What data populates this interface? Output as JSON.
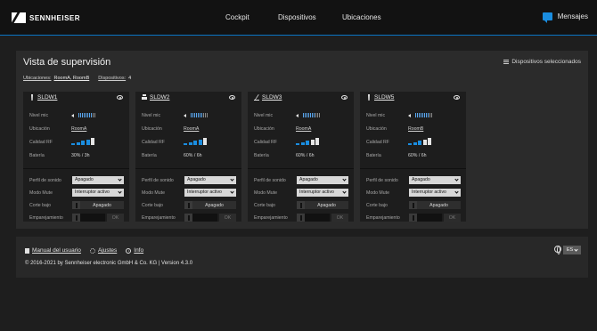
{
  "header": {
    "brand": "SENNHEISER",
    "nav": [
      "Cockpit",
      "Dispositivos",
      "Ubicaciones"
    ],
    "messages_label": "Mensajes"
  },
  "overview": {
    "title": "Vista de supervisión",
    "selected_devices": "Dispositivos seleccionados",
    "filters": {
      "locations_label": "Ubicaciones:",
      "locations_value": "RoomA, RoomB",
      "devices_label": "Dispositivos:",
      "devices_value": "4"
    }
  },
  "labels": {
    "mic_level": "Nivel mic",
    "location": "Ubicación",
    "rf_quality": "Calidad RF",
    "battery": "Batería",
    "sound_profile": "Perfil de sonido",
    "mute_mode": "Modo Mute",
    "low_cut": "Corte bajo",
    "pairing": "Emparejamiento",
    "ok": "OK"
  },
  "devices": [
    {
      "name": "SLDW1",
      "icon": "handheld-mic-icon",
      "location": "RoomA",
      "battery": "30% / 3h",
      "sound_profile": "Apagado",
      "mute_mode": "Interruptor activo",
      "low_cut": "Apagado",
      "mic_active_bars": 8,
      "rf_level": 4
    },
    {
      "name": "SLDW2",
      "icon": "table-mic-icon",
      "location": "RoomA",
      "battery": "60% / 6h",
      "sound_profile": "Apagado",
      "mute_mode": "Interruptor activo",
      "low_cut": "Apagado",
      "mic_active_bars": 7,
      "rf_level": 4
    },
    {
      "name": "SLDW3",
      "icon": "gooseneck-mic-icon",
      "location": "RoomA",
      "battery": "60% / 6h",
      "sound_profile": "Apagado",
      "mute_mode": "Interruptor activo",
      "low_cut": "Apagado",
      "mic_active_bars": 7,
      "rf_level": 3
    },
    {
      "name": "SLDW5",
      "icon": "handheld-mic-icon",
      "location": "RoomB",
      "battery": "60% / 6h",
      "sound_profile": "Apagado",
      "mute_mode": "Interruptor activo",
      "low_cut": "Apagado",
      "mic_active_bars": 8,
      "rf_level": 3
    }
  ],
  "footer": {
    "manual": "Manual del usuario",
    "settings": "Ajustes",
    "info": "Info",
    "copyright": "© 2016-2021 by Sennheiser electronic GmbH & Co. KG | Version 4.3.0",
    "language": "ES"
  },
  "colors": {
    "accent": "#1a8de0",
    "panel": "#2b2b2b",
    "card": "#1d1d1d"
  }
}
